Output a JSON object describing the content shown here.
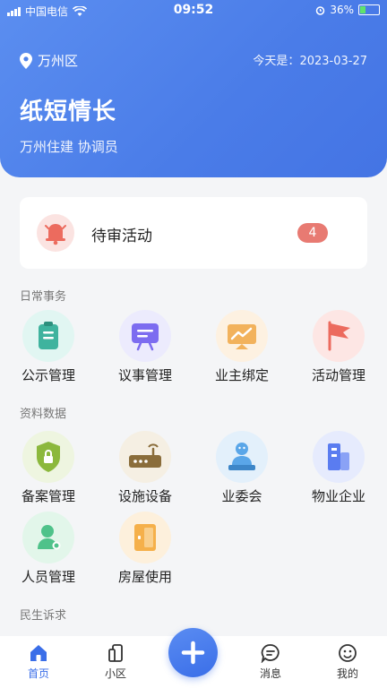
{
  "status": {
    "carrier": "中国电信",
    "time": "09:52",
    "battery": "36%",
    "battery_level": 0.36
  },
  "header": {
    "location": "万州区",
    "date_label": "今天是：",
    "date": "2023-03-27",
    "title": "纸短情长",
    "role": "万州住建 协调员"
  },
  "pending": {
    "label": "待审活动",
    "count": "4"
  },
  "sections": [
    {
      "title": "日常事务",
      "items": [
        {
          "label": "公示管理",
          "icon": "clipboard-icon",
          "color": "#3fb39e"
        },
        {
          "label": "议事管理",
          "icon": "presentation-icon",
          "color": "#7c6cf0"
        },
        {
          "label": "业主绑定",
          "icon": "chart-board-icon",
          "color": "#f2b25c"
        },
        {
          "label": "活动管理",
          "icon": "flag-icon",
          "color": "#ec6b5e"
        }
      ]
    },
    {
      "title": "资料数据",
      "items": [
        {
          "label": "备案管理",
          "icon": "shield-lock-icon",
          "color": "#8cb83d"
        },
        {
          "label": "设施设备",
          "icon": "router-icon",
          "color": "#8a6d3b"
        },
        {
          "label": "业委会",
          "icon": "committee-icon",
          "color": "#5aa6e8"
        },
        {
          "label": "物业企业",
          "icon": "building-icon",
          "color": "#5a7cf0"
        },
        {
          "label": "人员管理",
          "icon": "person-icon",
          "color": "#4fc28a"
        },
        {
          "label": "房屋使用",
          "icon": "door-icon",
          "color": "#f5b04a"
        }
      ]
    },
    {
      "title": "民生诉求",
      "items": []
    }
  ],
  "tabs": [
    {
      "label": "首页",
      "icon": "home-icon",
      "active": true
    },
    {
      "label": "小区",
      "icon": "phone-icon"
    },
    {
      "label": "消息",
      "icon": "message-icon"
    },
    {
      "label": "我的",
      "icon": "smile-icon"
    }
  ],
  "colors": {
    "primary": "#4a7ce8",
    "badge": "#e87a72",
    "bell": "#ec6b5e"
  }
}
